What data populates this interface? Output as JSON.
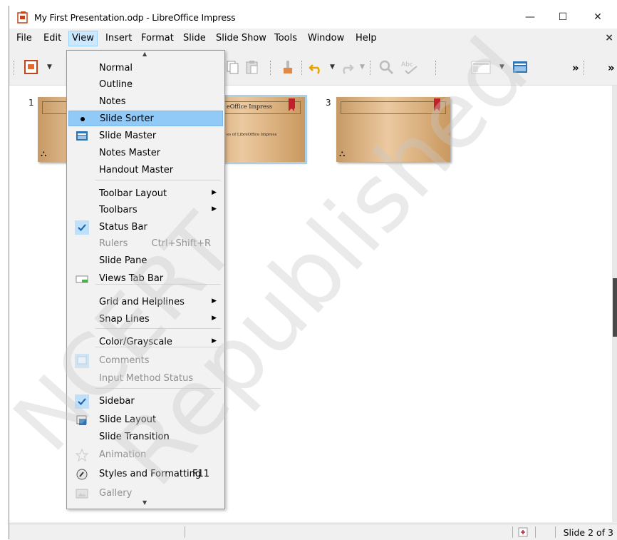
{
  "window": {
    "title": "My First Presentation.odp - LibreOffice Impress",
    "minimize": "—",
    "maximize": "☐",
    "close": "✕"
  },
  "menubar": {
    "items": [
      "File",
      "Edit",
      "View",
      "Insert",
      "Format",
      "Slide",
      "Slide Show",
      "Tools",
      "Window",
      "Help"
    ],
    "close": "×"
  },
  "toolbar": {
    "overflow": "»"
  },
  "slides": [
    {
      "number": "1",
      "title_text": "",
      "body_text": ""
    },
    {
      "number": "2",
      "title_text": "eOffice Impress",
      "body_text": "es of LibreOffice Impress"
    },
    {
      "number": "3",
      "title_text": "",
      "body_text": ""
    }
  ],
  "view_menu": {
    "items": [
      {
        "label": "Normal",
        "enabled": true,
        "icon": "",
        "shortcut": "",
        "submenu": false
      },
      {
        "label": "Outline",
        "enabled": true,
        "icon": "",
        "shortcut": "",
        "submenu": false
      },
      {
        "label": "Notes",
        "enabled": true,
        "icon": "",
        "shortcut": "",
        "submenu": false
      },
      {
        "label": "Slide Sorter",
        "enabled": true,
        "icon": "radio-dot-icon",
        "shortcut": "",
        "submenu": false,
        "highlighted": true
      },
      {
        "label": "Slide Master",
        "enabled": true,
        "icon": "slide-master-icon",
        "shortcut": "",
        "submenu": false
      },
      {
        "label": "Notes Master",
        "enabled": true,
        "icon": "",
        "shortcut": "",
        "submenu": false
      },
      {
        "label": "Handout Master",
        "enabled": true,
        "icon": "",
        "shortcut": "",
        "submenu": false
      },
      {
        "label": "Toolbar Layout",
        "enabled": true,
        "icon": "",
        "shortcut": "",
        "submenu": true
      },
      {
        "label": "Toolbars",
        "enabled": true,
        "icon": "",
        "shortcut": "",
        "submenu": true
      },
      {
        "label": "Status Bar",
        "enabled": true,
        "icon": "checkmark-icon",
        "shortcut": "",
        "submenu": false
      },
      {
        "label": "Rulers",
        "enabled": false,
        "icon": "",
        "shortcut": "Ctrl+Shift+R",
        "submenu": false
      },
      {
        "label": "Slide Pane",
        "enabled": true,
        "icon": "",
        "shortcut": "",
        "submenu": false
      },
      {
        "label": "Views Tab Bar",
        "enabled": true,
        "icon": "views-tab-icon",
        "shortcut": "",
        "submenu": false
      },
      {
        "label": "Grid and Helplines",
        "enabled": true,
        "icon": "",
        "shortcut": "",
        "submenu": true
      },
      {
        "label": "Snap Lines",
        "enabled": true,
        "icon": "",
        "shortcut": "",
        "submenu": true
      },
      {
        "label": "Color/Grayscale",
        "enabled": true,
        "icon": "",
        "shortcut": "",
        "submenu": true
      },
      {
        "label": "Comments",
        "enabled": false,
        "icon": "comments-icon",
        "shortcut": "",
        "submenu": false
      },
      {
        "label": "Input Method Status",
        "enabled": false,
        "icon": "",
        "shortcut": "",
        "submenu": false
      },
      {
        "label": "Sidebar",
        "enabled": true,
        "icon": "checkmark-icon",
        "shortcut": "",
        "submenu": false
      },
      {
        "label": "Slide Layout",
        "enabled": true,
        "icon": "slide-layout-icon",
        "shortcut": "",
        "submenu": false
      },
      {
        "label": "Slide Transition",
        "enabled": true,
        "icon": "",
        "shortcut": "",
        "submenu": false
      },
      {
        "label": "Animation",
        "enabled": false,
        "icon": "animation-icon",
        "shortcut": "",
        "submenu": false
      },
      {
        "label": "Styles and Formatting",
        "enabled": true,
        "icon": "styles-icon",
        "shortcut": "F11",
        "submenu": false
      },
      {
        "label": "Gallery",
        "enabled": false,
        "icon": "gallery-icon",
        "shortcut": "",
        "submenu": false
      }
    ]
  },
  "statusbar": {
    "slide_info": "Slide 2 of 3"
  },
  "watermark": {
    "line1": "NCERT",
    "line2": "Republished"
  },
  "colors": {
    "menu_highlight": "#91c9f7",
    "active_menu": "#cce8ff",
    "slide_bg": "#e2b989",
    "ribbon": "#c3202e"
  }
}
